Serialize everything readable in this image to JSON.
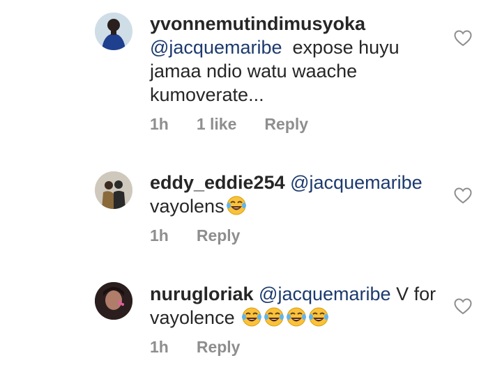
{
  "comments": [
    {
      "username": "yvonnemutindimusyoka",
      "mention": "@jacquemaribe",
      "text_lines": [
        "expose huyu",
        "jamaa ndio watu waache",
        "kumoverate..."
      ],
      "time": "1h",
      "likes": "1 like",
      "reply": "Reply"
    },
    {
      "username": "eddy_eddie254",
      "mention": "@jacquemaribe",
      "text": "vayolens",
      "emoji_count": 1,
      "time": "1h",
      "reply": "Reply"
    },
    {
      "username": "nurugloriak",
      "mention": "@jacquemaribe",
      "text_first": "V for",
      "text_second": "vayolence",
      "emoji_count": 4,
      "time": "1h",
      "reply": "Reply"
    }
  ],
  "icons": {
    "like": "heart-outline-icon",
    "emoji": "face-with-tears-of-joy-emoji"
  },
  "colors": {
    "text": "#262626",
    "meta": "#8e8e8e",
    "mention": "#1c3a6e"
  }
}
